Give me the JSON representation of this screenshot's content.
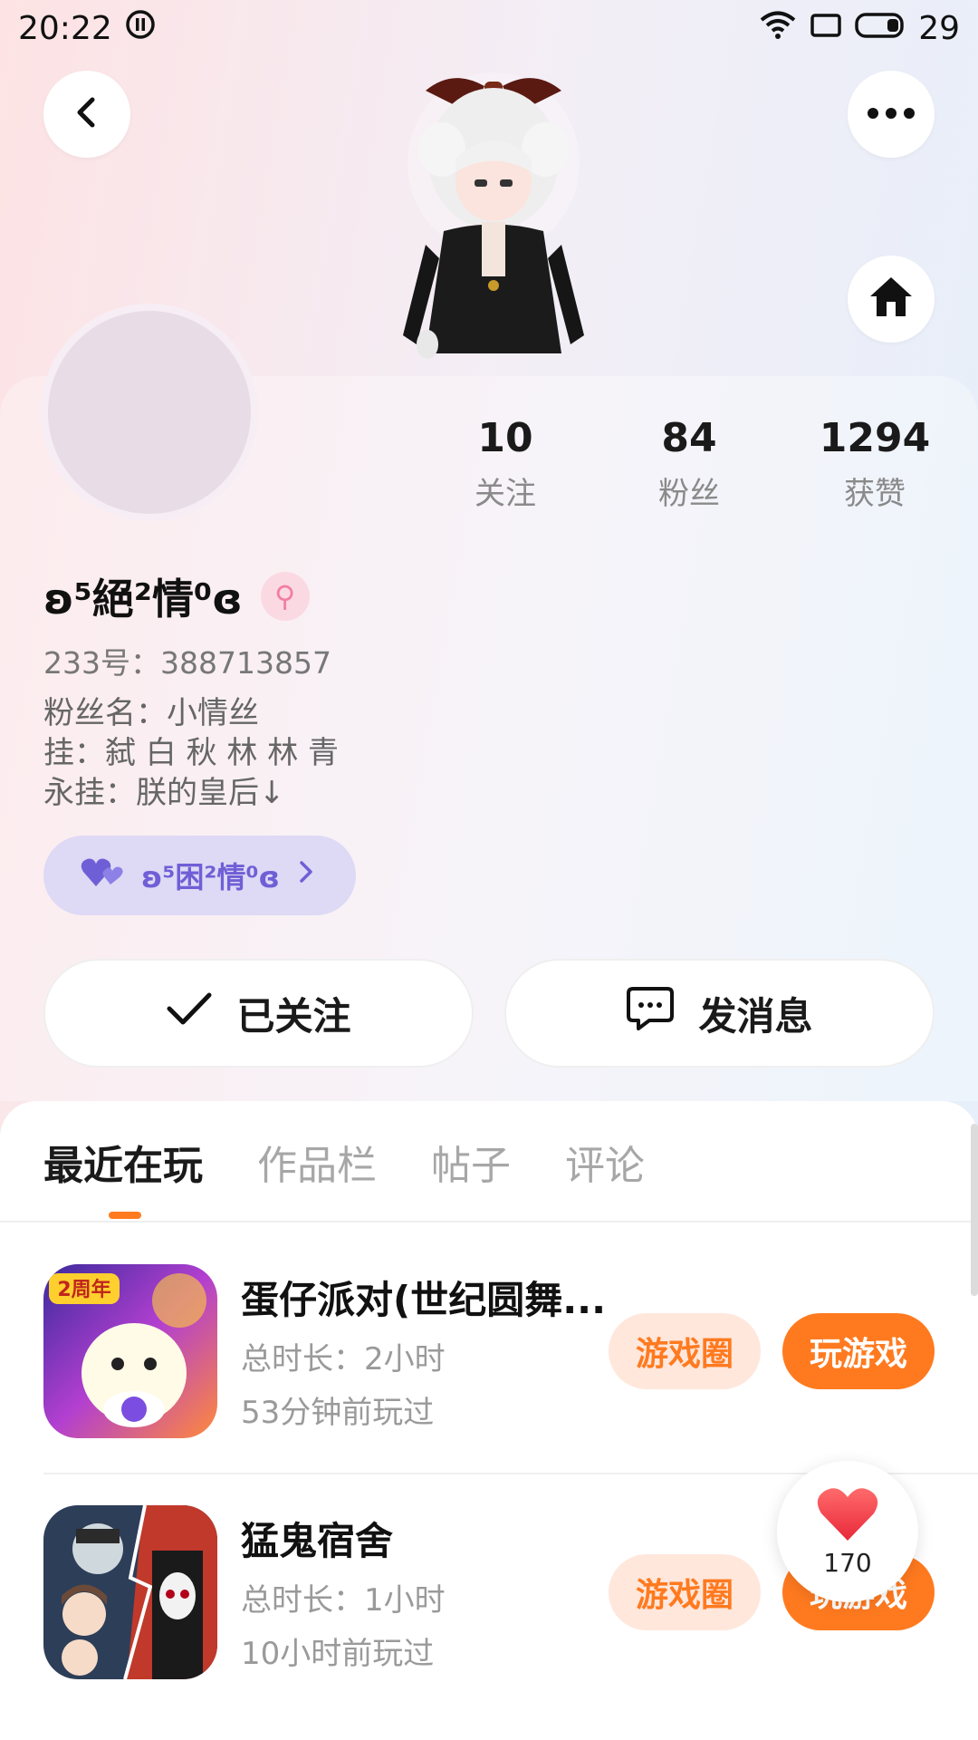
{
  "status_bar": {
    "time": "20:22",
    "battery": "29"
  },
  "stats": [
    {
      "value": "10",
      "label": "关注"
    },
    {
      "value": "84",
      "label": "粉丝"
    },
    {
      "value": "1294",
      "label": "获赞"
    }
  ],
  "profile": {
    "username": "ʚ⁵絕²情⁰ɞ",
    "gender_symbol": "⚲",
    "uid": "233号：388713857",
    "bio_lines": [
      "粉丝名：小情丝",
      "挂：弑 白 秋 林 林 青",
      "永挂：朕的皇后↓"
    ],
    "cp_name": "ʚ⁵困²情⁰ɞ"
  },
  "actions": {
    "follow_label": "已关注",
    "message_label": "发消息"
  },
  "tabs": [
    "最近在玩",
    "作品栏",
    "帖子",
    "评论"
  ],
  "games": [
    {
      "title": "蛋仔派对(世纪圆舞...",
      "total_time": "总时长：2小时",
      "last_played": "53分钟前玩过",
      "circle_label": "游戏圈",
      "play_label": "玩游戏",
      "icon_badge": "2周年"
    },
    {
      "title": "猛鬼宿舍",
      "total_time": "总时长：1小时",
      "last_played": "10小时前玩过",
      "circle_label": "游戏圈",
      "play_label": "玩游戏"
    }
  ],
  "like_float": {
    "count": "170"
  },
  "colors": {
    "accent": "#ff7a1f",
    "accent_light": "#ffe7dc",
    "cp_pill": "#ded9f5",
    "cp_text": "#6f5fd6",
    "gender": "#f27fa2"
  }
}
